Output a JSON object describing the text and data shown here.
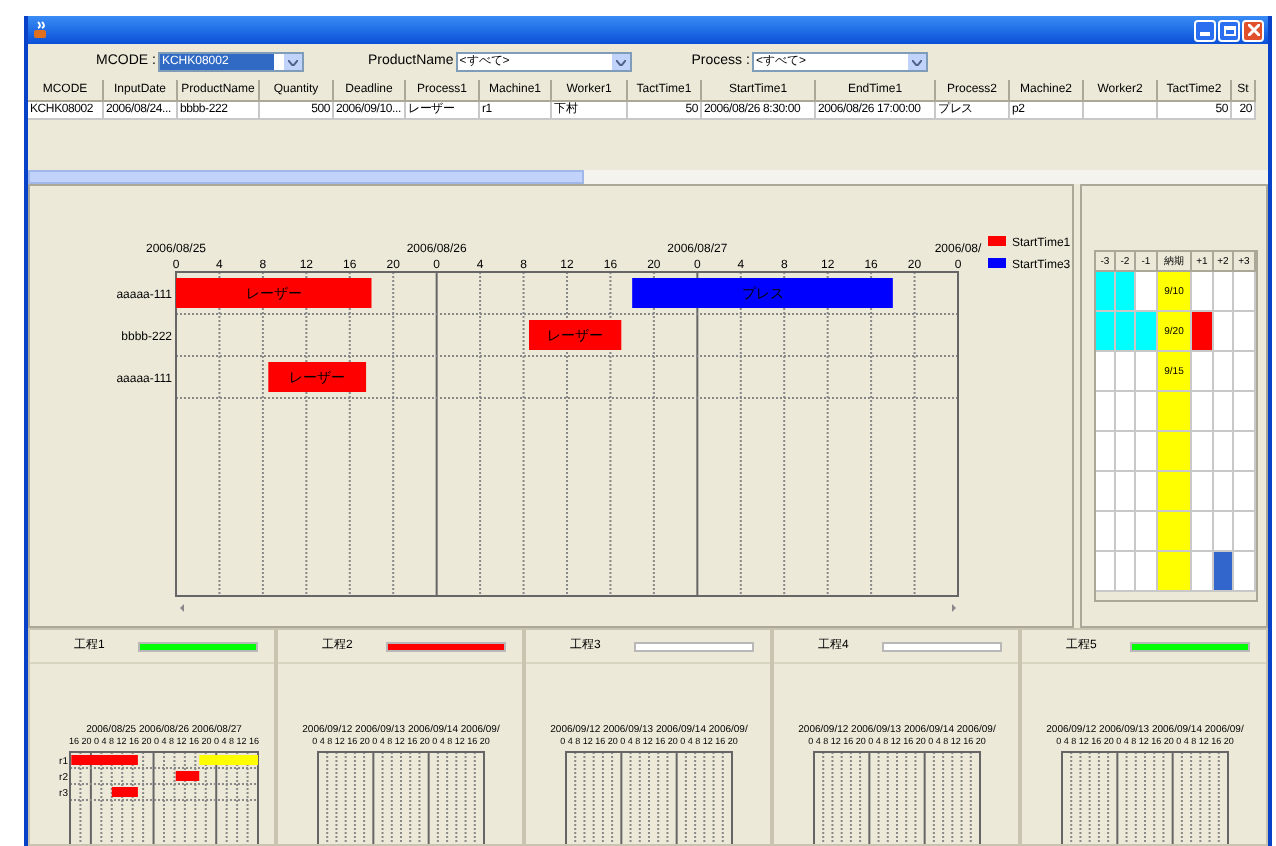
{
  "filters": [
    {
      "label": "MCODE :",
      "value": "KCHK08002",
      "selected": true
    },
    {
      "label": "ProductName",
      "value": "<すべて>",
      "selected": false
    },
    {
      "label": "Process :",
      "value": "<すべて>",
      "selected": false
    }
  ],
  "orders_table": {
    "columns": [
      "MCODE",
      "InputDate",
      "ProductName",
      "Quantity",
      "Deadline",
      "Process1",
      "Machine1",
      "Worker1",
      "TactTime1",
      "StartTime1",
      "EndTime1",
      "Process2",
      "Machine2",
      "Worker2",
      "TactTime2",
      "St"
    ],
    "rows": [
      {
        "cells": [
          "KCHK08002",
          "2006/08/24...",
          "bbbb-222",
          "500",
          "2006/09/10...",
          "レーザー",
          "r1",
          "下村",
          "50",
          "2006/08/26 8:30:00",
          "2006/08/26 17:00:00",
          "プレス",
          "p2",
          "",
          "50",
          "20"
        ]
      }
    ]
  },
  "gantt": {
    "date_labels": [
      "2006/08/25",
      "2006/08/26",
      "2006/08/27",
      "2006/08/"
    ],
    "hour_labels": [
      "0",
      "4",
      "8",
      "12",
      "16",
      "20",
      "0",
      "4",
      "8",
      "12",
      "16",
      "20",
      "0",
      "4",
      "8",
      "12",
      "16",
      "20",
      "0"
    ],
    "rows": [
      {
        "label": "aaaaa-111",
        "bars": [
          {
            "label": "レーザー",
            "color": "#ff0000"
          },
          {
            "label": "プレス",
            "color": "#0000ff"
          }
        ]
      },
      {
        "label": "bbbb-222",
        "bars": [
          {
            "label": "レーザー",
            "color": "#ff0000"
          }
        ]
      },
      {
        "label": "aaaaa-111",
        "bars": [
          {
            "label": "レーザー",
            "color": "#ff0000"
          }
        ]
      }
    ],
    "legend": [
      {
        "name": "StartTime1",
        "color": "#ff0000"
      },
      {
        "name": "StartTime3",
        "color": "#0000ff"
      }
    ]
  },
  "deadline_grid": {
    "columns": [
      "-3",
      "-2",
      "-1",
      "納期",
      "+1",
      "+2",
      "+3"
    ],
    "rows": [
      {
        "cells": [
          {
            "color": "#00ffff"
          },
          {
            "color": "#00ffff"
          },
          {
            "color": "#ffffff"
          },
          {
            "color": "#ffff00",
            "text": "9/10"
          },
          {
            "color": "#ffffff"
          },
          {
            "color": "#ffffff"
          },
          {
            "color": "#ffffff"
          }
        ]
      },
      {
        "cells": [
          {
            "color": "#00ffff"
          },
          {
            "color": "#00ffff"
          },
          {
            "color": "#00ffff"
          },
          {
            "color": "#ffff00",
            "text": "9/20"
          },
          {
            "color": "#ff0000"
          },
          {
            "color": "#ffffff"
          },
          {
            "color": "#ffffff"
          }
        ]
      },
      {
        "cells": [
          {
            "color": "#ffffff"
          },
          {
            "color": "#ffffff"
          },
          {
            "color": "#ffffff"
          },
          {
            "color": "#ffff00",
            "text": "9/15"
          },
          {
            "color": "#ffffff"
          },
          {
            "color": "#ffffff"
          },
          {
            "color": "#ffffff"
          }
        ]
      },
      {
        "cells": [
          {
            "color": "#ffffff"
          },
          {
            "color": "#ffffff"
          },
          {
            "color": "#ffffff"
          },
          {
            "color": "#ffff00"
          },
          {
            "color": "#ffffff"
          },
          {
            "color": "#ffffff"
          },
          {
            "color": "#ffffff"
          }
        ]
      },
      {
        "cells": [
          {
            "color": "#ffffff"
          },
          {
            "color": "#ffffff"
          },
          {
            "color": "#ffffff"
          },
          {
            "color": "#ffff00"
          },
          {
            "color": "#ffffff"
          },
          {
            "color": "#ffffff"
          },
          {
            "color": "#ffffff"
          }
        ]
      },
      {
        "cells": [
          {
            "color": "#ffffff"
          },
          {
            "color": "#ffffff"
          },
          {
            "color": "#ffffff"
          },
          {
            "color": "#ffff00"
          },
          {
            "color": "#ffffff"
          },
          {
            "color": "#ffffff"
          },
          {
            "color": "#ffffff"
          }
        ]
      },
      {
        "cells": [
          {
            "color": "#ffffff"
          },
          {
            "color": "#ffffff"
          },
          {
            "color": "#ffffff"
          },
          {
            "color": "#ffff00"
          },
          {
            "color": "#ffffff"
          },
          {
            "color": "#ffffff"
          },
          {
            "color": "#ffffff"
          }
        ]
      },
      {
        "cells": [
          {
            "color": "#ffffff"
          },
          {
            "color": "#ffffff"
          },
          {
            "color": "#ffffff"
          },
          {
            "color": "#ffff00"
          },
          {
            "color": "#ffffff"
          },
          {
            "color": "#3366cc"
          },
          {
            "color": "#ffffff"
          }
        ]
      }
    ]
  },
  "process_panels": [
    {
      "label": "工程1",
      "color": "#00ff00",
      "date_labels": "2006/08/25 2006/08/26 2006/08/27",
      "hour_labels": "16 20 0 4 8 12 16 20 0 4 8 12 16 20 0 4 8 12 16",
      "rows": [
        {
          "label": "r1",
          "bars": [
            {
              "color": "#ff0000"
            },
            {
              "color": "#ffff00"
            }
          ]
        },
        {
          "label": "r2",
          "bars": [
            {
              "color": "#ff0000"
            }
          ]
        },
        {
          "label": "r3",
          "bars": [
            {
              "color": "#ff0000"
            }
          ]
        }
      ]
    },
    {
      "label": "工程2",
      "color": "#ff0000",
      "date_labels": "2006/09/12 2006/09/13 2006/09/14 2006/09/",
      "hour_labels": "0 4 8 12 16 20 0 4 8 12 16 20 0 4 8 12 16 20"
    },
    {
      "label": "工程3",
      "color": "#ffffff",
      "date_labels": "2006/09/12 2006/09/13 2006/09/14 2006/09/",
      "hour_labels": "0 4 8 12 16 20 0 4 8 12 16 20 0 4 8 12 16 20"
    },
    {
      "label": "工程4",
      "color": "#ffffff",
      "date_labels": "2006/09/12 2006/09/13 2006/09/14 2006/09/",
      "hour_labels": "0 4 8 12 16 20 0 4 8 12 16 20 0 4 8 12 16 20"
    },
    {
      "label": "工程5",
      "color": "#00ff00",
      "date_labels": "2006/09/12 2006/09/13 2006/09/14 2006/09/",
      "hour_labels": "0 4 8 12 16 20 0 4 8 12 16 20 0 4 8 12 16 20"
    }
  ]
}
